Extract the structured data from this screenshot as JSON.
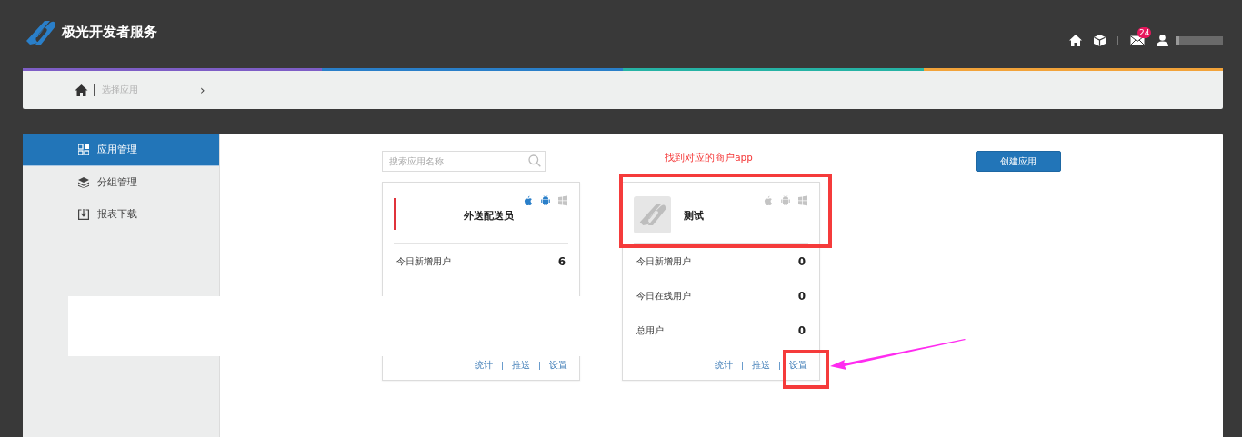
{
  "header": {
    "logo_text": "极光开发者服务",
    "message_badge": "24"
  },
  "breadcrumb": {
    "items": [
      "选择应用"
    ],
    "chevron": "›"
  },
  "sidebar": {
    "items": [
      {
        "label": "应用管理",
        "selected": true
      },
      {
        "label": "分组管理",
        "selected": false
      },
      {
        "label": "报表下载",
        "selected": false
      }
    ]
  },
  "search": {
    "placeholder": "搜索应用名称"
  },
  "create_button": "创建应用",
  "apps": [
    {
      "name": "外送配送员",
      "kind": "no-logo",
      "highlighted": false,
      "platforms": [
        {
          "enabled": true
        },
        {
          "enabled": true
        },
        {
          "enabled": false
        }
      ],
      "stats": [
        {
          "label": "今日新增用户",
          "value": "6"
        }
      ],
      "links": [
        "统计",
        "推送",
        "设置"
      ]
    },
    {
      "name": "测试",
      "kind": "logo",
      "highlighted": true,
      "annotation": "找到对应的商户app",
      "platforms": [
        {
          "enabled": false
        },
        {
          "enabled": false
        },
        {
          "enabled": false
        }
      ],
      "stats": [
        {
          "label": "今日新增用户",
          "value": "0"
        },
        {
          "label": "今日在线用户",
          "value": "0"
        },
        {
          "label": "总用户",
          "value": "0"
        }
      ],
      "links": [
        "统计",
        "推送",
        "设置"
      ]
    }
  ]
}
